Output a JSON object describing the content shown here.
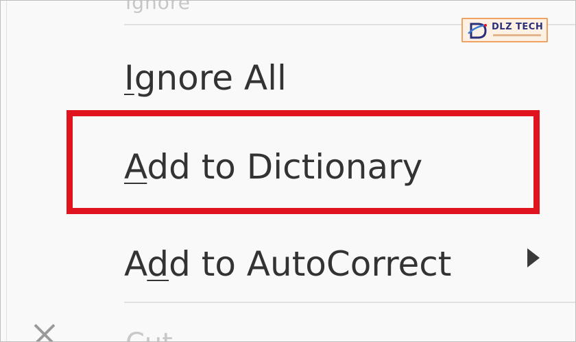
{
  "context_menu": {
    "partial_top_item": "Ignore",
    "items": [
      {
        "before": "",
        "key": "I",
        "after": "gnore All",
        "submenu": false
      },
      {
        "before": "",
        "key": "A",
        "after": "dd to Dictionary",
        "submenu": false,
        "highlighted": true
      },
      {
        "before": "A",
        "key": "d",
        "after": "d to AutoCorrect",
        "submenu": true
      }
    ],
    "partial_bottom_item": "Cut",
    "bottom_icon": "close-x-icon",
    "highlight_color": "#e0141e"
  },
  "watermark": {
    "logo_text": "DLZ TECH",
    "icon": "dlz-tech-logo-icon",
    "border_color": "#f0a060",
    "text_color": "#2a2f7a"
  }
}
